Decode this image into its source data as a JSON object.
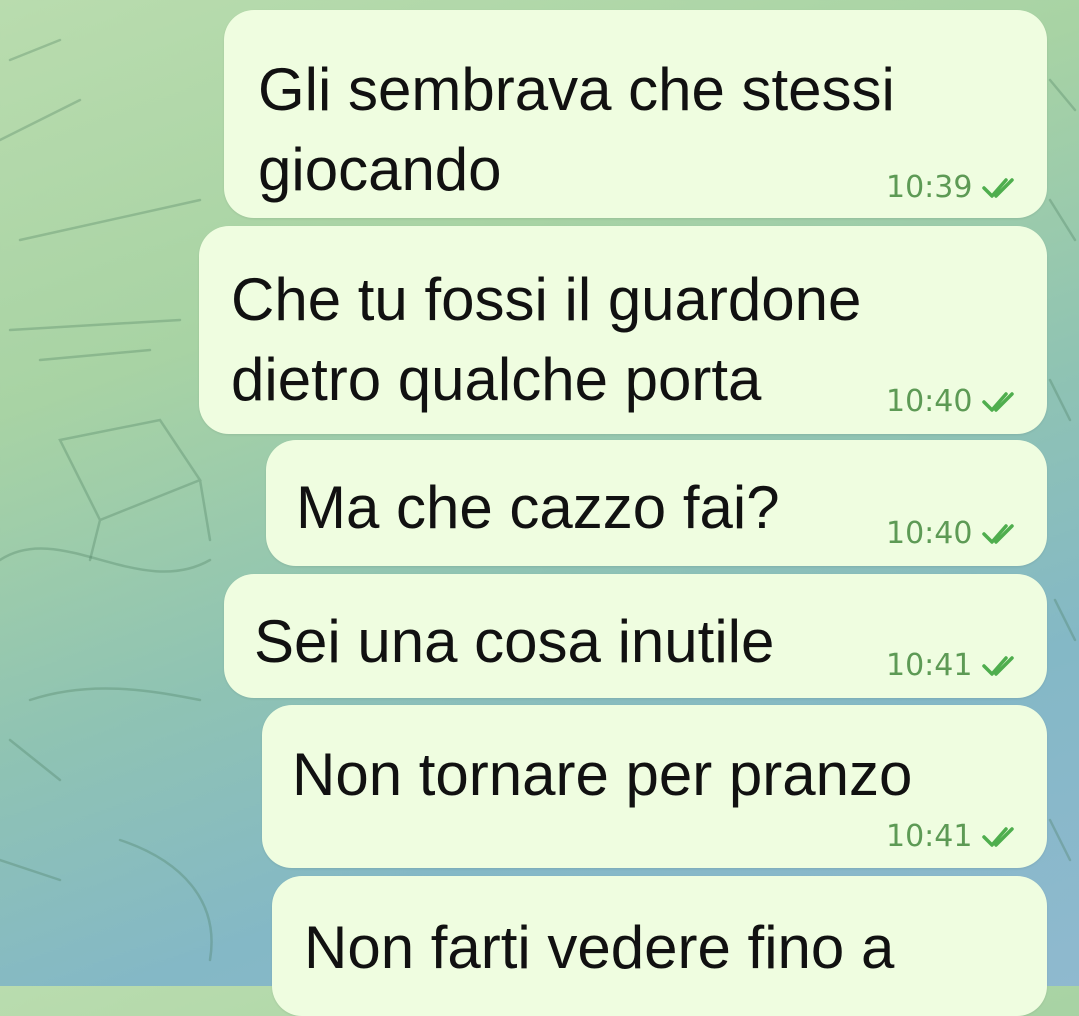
{
  "messages": [
    {
      "text_lines": [
        "Gli sembrava che stessi",
        "giocando"
      ],
      "time": "10:39",
      "status": "read-double-check-icon"
    },
    {
      "text_lines": [
        "Che tu fossi il guardone",
        "dietro qualche porta"
      ],
      "time": "10:40",
      "status": "read-double-check-icon"
    },
    {
      "text_lines": [
        "Ma che cazzo fai?"
      ],
      "time": "10:40",
      "status": "read-double-check-icon"
    },
    {
      "text_lines": [
        "Sei una cosa inutile"
      ],
      "time": "10:41",
      "status": "read-double-check-icon"
    },
    {
      "text_lines": [
        "Non tornare per pranzo"
      ],
      "time": "10:41",
      "status": "read-double-check-icon"
    },
    {
      "text_lines": [
        "Non farti vedere fino a"
      ],
      "time": "",
      "status": ""
    }
  ],
  "colors": {
    "bubble": "#effde0",
    "time": "#5d9a55",
    "check": "#4fae4e"
  }
}
